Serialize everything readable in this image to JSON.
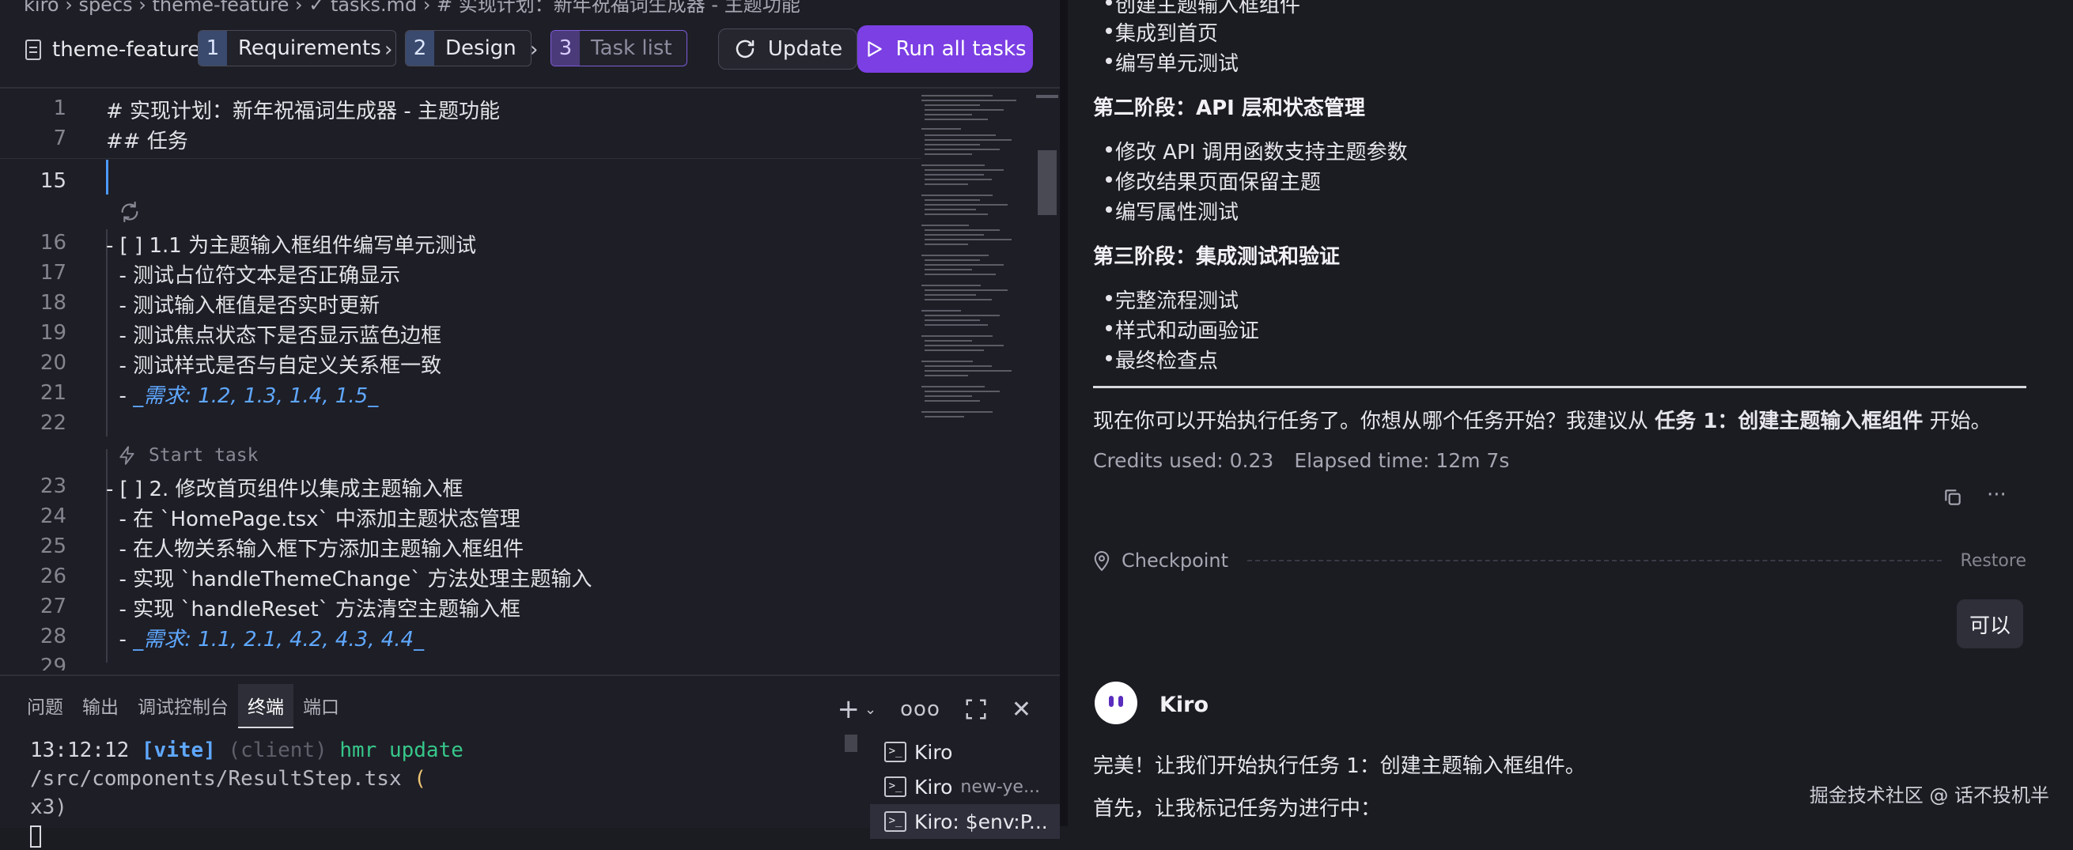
{
  "editor_tab": {
    "breadcrumb": "kiro  ›  specs  ›  theme-feature  ›  ✓ tasks.md  ›  # 实现计划：新年祝福词生成器 - 主题功能"
  },
  "toolbar": {
    "file_name": "theme-feature",
    "steps": [
      {
        "num": "1",
        "label": "Requirements"
      },
      {
        "num": "2",
        "label": "Design"
      },
      {
        "num": "3",
        "label": "Task list"
      }
    ],
    "update_label": "Update",
    "run_label": "Run all tasks"
  },
  "editor": {
    "sticky": [
      {
        "ln": "1",
        "text": "# 实现计划：新年祝福词生成器 - 主题功能"
      },
      {
        "ln": "7",
        "text": "## 任务"
      }
    ],
    "current_line": "15",
    "start_task_label": "Start task",
    "lines": [
      {
        "ln": "16",
        "text": "- [ ] 1.1 为主题输入框组件编写单元测试"
      },
      {
        "ln": "17",
        "text": "  - 测试占位符文本是否正确显示"
      },
      {
        "ln": "18",
        "text": "  - 测试输入框值是否实时更新"
      },
      {
        "ln": "19",
        "text": "  - 测试焦点状态下是否显示蓝色边框"
      },
      {
        "ln": "20",
        "text": "  - 测试样式是否与自定义关系框一致"
      },
      {
        "ln": "21",
        "text": "  - ",
        "req": "_需求: 1.2, 1.3, 1.4, 1.5_"
      },
      {
        "ln": "22",
        "text": ""
      },
      {
        "ln": "23",
        "text": "- [ ] 2. 修改首页组件以集成主题输入框"
      },
      {
        "ln": "24",
        "text": "  - 在 `HomePage.tsx` 中添加主题状态管理"
      },
      {
        "ln": "25",
        "text": "  - 在人物关系输入框下方添加主题输入框组件"
      },
      {
        "ln": "26",
        "text": "  - 实现 `handleThemeChange` 方法处理主题输入"
      },
      {
        "ln": "27",
        "text": "  - 实现 `handleReset` 方法清空主题输入框"
      },
      {
        "ln": "28",
        "text": "  - ",
        "req": "_需求: 1.1, 2.1, 4.2, 4.3, 4.4_"
      },
      {
        "ln": "29",
        "text": ""
      }
    ]
  },
  "panel": {
    "tabs": [
      "问题",
      "输出",
      "调试控制台",
      "终端",
      "端口"
    ],
    "active_tab": "终端",
    "terminal": {
      "time": "13:12:12",
      "vite": "[vite]",
      "client": "(client)",
      "hmr": "hmr update",
      "path": "/src/components/ResultStep.tsx",
      "paren_open": "(",
      "count": "x3)"
    },
    "terminals": [
      {
        "name": "Kiro",
        "sub": ""
      },
      {
        "name": "Kiro",
        "sub": "new-ye..."
      },
      {
        "name": "Kiro: $env:P...",
        "sub": ""
      }
    ]
  },
  "chat": {
    "top_bullets": [
      "创建主题输入框组件",
      "集成到首页",
      "编写单元测试"
    ],
    "phase2_title": "第二阶段：API 层和状态管理",
    "phase2_bullets": [
      "修改 API 调用函数支持主题参数",
      "修改结果页面保留主题",
      "编写属性测试"
    ],
    "phase3_title": "第三阶段：集成测试和验证",
    "phase3_bullets": [
      "完整流程测试",
      "样式和动画验证",
      "最终检查点"
    ],
    "suggest_pre": "现在你可以开始执行任务了。你想从哪个任务开始？我建议从 ",
    "suggest_bold": "任务 1：创建主题输入框组件",
    "suggest_post": " 开始。",
    "credits": "Credits used: 0.23",
    "elapsed": "Elapsed time: 12m 7s",
    "checkpoint_label": "Checkpoint",
    "restore_label": "Restore",
    "user_message": "可以",
    "assistant_name": "Kiro",
    "reply_1": "完美！让我们开始执行任务 1：创建主题输入框组件。",
    "reply_2": "首先，让我标记任务为进行中：",
    "watermark": "掘金技术社区 @ 话不投机半"
  },
  "colors": {
    "accent": "#7b3fe4",
    "link_blue": "#5fa8ff",
    "heading_yellow": "#f0c674",
    "terminal_green": "#36c78a"
  }
}
